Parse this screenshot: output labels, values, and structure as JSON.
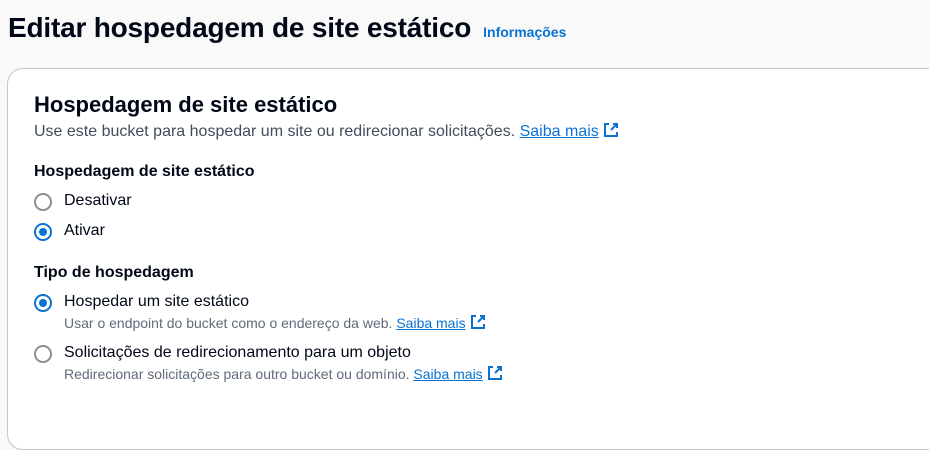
{
  "header": {
    "title": "Editar hospedagem de site estático",
    "info_link": "Informações"
  },
  "panel": {
    "title": "Hospedagem de site estático",
    "description": "Use este bucket para hospedar um site ou redirecionar solicitações.",
    "learn_more": "Saiba mais",
    "hosting_field": {
      "label": "Hospedagem de site estático",
      "options": [
        {
          "label": "Desativar",
          "selected": false
        },
        {
          "label": "Ativar",
          "selected": true
        }
      ]
    },
    "type_field": {
      "label": "Tipo de hospedagem",
      "options": [
        {
          "label": "Hospedar um site estático",
          "description": "Usar o endpoint do bucket como o endereço da web.",
          "link": "Saiba mais",
          "selected": true
        },
        {
          "label": "Solicitações de redirecionamento para um objeto",
          "description": "Redirecionar solicitações para outro bucket ou domínio.",
          "link": "Saiba mais",
          "selected": false
        }
      ]
    }
  },
  "colors": {
    "accent": "#0972d3",
    "text": "#000716",
    "muted": "#5f6b7a",
    "border": "#c6c6cd",
    "page_background": "#f9f9f9"
  }
}
